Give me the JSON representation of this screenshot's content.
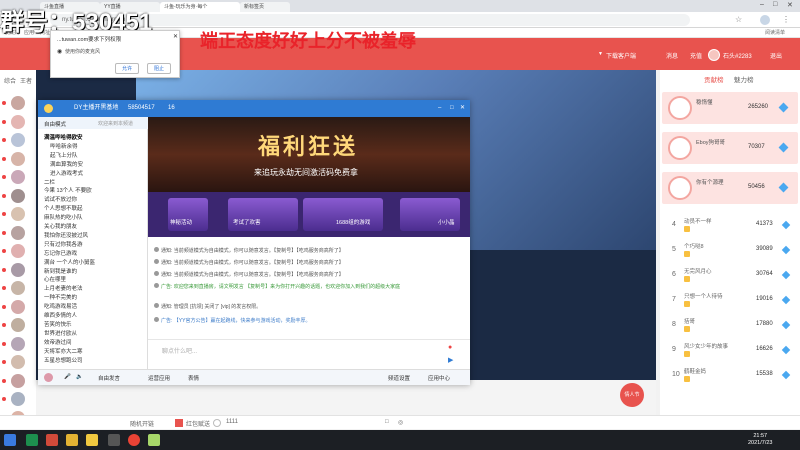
{
  "browser": {
    "tabs": [
      "斗鱼直播",
      "YY直播",
      "斗鱼-玩乐为身·每个",
      "新标签页"
    ],
    "url": "ny.tuwan.com/chatroom",
    "bookmarks": [
      "收藏夹",
      "应用",
      "网址导航"
    ],
    "reading_list": "阅读清单"
  },
  "overlay": {
    "group_number": "群号：530451",
    "slogan": "端正态度好好上分不被羞辱"
  },
  "popup": {
    "title": "...tuwan.com要求下列权限",
    "text": "使用你的麦克风",
    "allow": "允许",
    "block": "阻止"
  },
  "site_header": {
    "download": "下载客户端",
    "message": "消息",
    "recharge": "充值",
    "user": "石头#2283",
    "logout": "退出"
  },
  "left": {
    "tab1": "综合",
    "tab2": "王者"
  },
  "yy": {
    "title": "DY主播开黑基地",
    "id": "58504517",
    "online": "16",
    "tool": "自由模式",
    "tool2": "欢迎来到本频道",
    "channels": [
      "满温哔哈得欧安",
      "哔哈新余得",
      "起飞上分队",
      "满血算我的安",
      "进入游戏考式",
      "二栏  ",
      "今果 13个人 不要欧",
      "试试不放过你",
      "个人思想不联起",
      "麻队热的吃小队",
      "关心我的朋友",
      "我怕你还没披过风",
      "只有过你我各游",
      "忘记你已游戏",
      "满台 一个人的小舅盔",
      "新到我是谁的",
      "心在哪里",
      "上月老妻的老法",
      "一种不完美的",
      "吃鸡游戏易活",
      "维西多情的人",
      "苦笑的快乐",
      "世界进付欧从",
      "效帝游过间",
      "天将军亦大二寒",
      "五星总想跑公司"
    ],
    "banner_big": "福利狂送",
    "banner_sub": "来追玩永劫无间激活码免费拿",
    "cards": [
      "神秘活动",
      "考试了欢害",
      "1688组的游戏",
      "小小晶"
    ],
    "messages": [
      "通知: 当前频道模式为自由模式，你可以随意发言。【复制号】【吃鸡服务商高所了】",
      "通知: 当前频道模式为自由模式，你可以随意发言。【复制号】【吃鸡服务商高所了】",
      "通知: 当前频道模式为自由模式，你可以随意发言。【复制号】【吃鸡服务商高所了】",
      "广告: 欢迎您来到直播房，请文明发言 【复制号】来为你打开兴趣的话题，也欢迎你加入到我们的超级大家庭",
      "通知: 管理员 [抗领] 关闭了 [vip] 的发言权限。",
      "广告: 【YY官方公告】赢在起跑线，快来参与游戏活动，奖励丰厚。"
    ],
    "input_placeholder": "聊点什么吧...",
    "bottom": [
      "自由发言",
      "运营应用",
      "表情",
      "频道设置",
      "应用中心"
    ]
  },
  "right_panel": {
    "tab1": "贡献榜",
    "tab2": "魅力榜",
    "top3": [
      {
        "name": "稳惰懂",
        "score": "265260"
      },
      {
        "name": "Eboy狗哥哥",
        "score": "70307"
      },
      {
        "name": "你有个源理",
        "score": "50456"
      }
    ],
    "rows": [
      {
        "rank": "4",
        "name": "动员不一样",
        "score": "41373"
      },
      {
        "rank": "5",
        "name": "个巧哒8",
        "score": "39089"
      },
      {
        "rank": "6",
        "name": "无完风月心",
        "score": "30764"
      },
      {
        "rank": "7",
        "name": "只想一个人待待",
        "score": "19016"
      },
      {
        "rank": "8",
        "name": "括哥",
        "score": "17880"
      },
      {
        "rank": "9",
        "name": "风少女少年的故事",
        "score": "16626"
      },
      {
        "rank": "10",
        "name": "鹤鞋金妈",
        "score": "15538"
      }
    ]
  },
  "page_bottom": {
    "item1": "随机开链",
    "item2": "红包赋送",
    "count": "1111"
  },
  "pink_button": "情人节",
  "taskbar": {
    "time": "21:57",
    "date": "2021/7/23"
  },
  "colors": {
    "brand": "#e8534e",
    "yy_blue": "#2f7bd3",
    "diamond": "#4aa8f0"
  }
}
